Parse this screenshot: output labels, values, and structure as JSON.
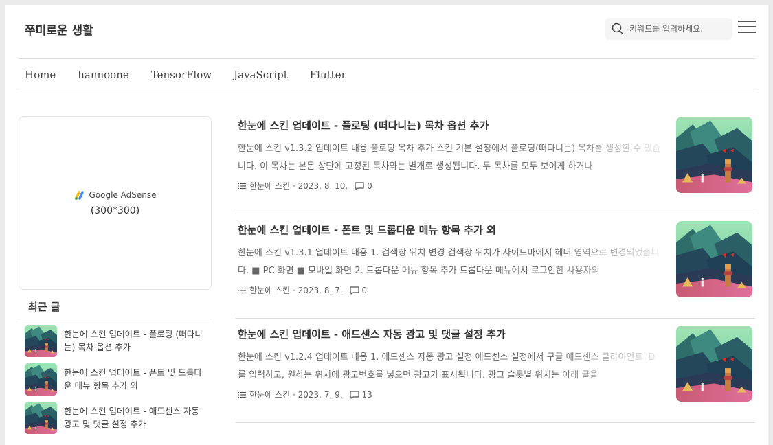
{
  "header": {
    "site_title": "쭈미로운 생활",
    "search_placeholder": "키워드를 입력하세요."
  },
  "nav": {
    "items": [
      "Home",
      "hannoone",
      "TensorFlow",
      "JavaScript",
      "Flutter"
    ]
  },
  "ad": {
    "brand": "Google AdSense",
    "size": "(300*300)"
  },
  "sidebar": {
    "recent_title": "최근 글",
    "recent": [
      {
        "title": "한눈에 스킨 업데이트 - 플로팅 (떠다니는) 목차 옵션 추가"
      },
      {
        "title": "한눈에 스킨 업데이트 - 폰트 및 드롭다운 메뉴 항목 추가 외"
      },
      {
        "title": "한눈에 스킨 업데이트 - 애드센스 자동 광고 및 댓글 설정 추가"
      }
    ]
  },
  "posts": [
    {
      "title": "한눈에 스킨 업데이트 - 플로팅 (떠다니는) 목차 옵션 추가",
      "excerpt": "한눈에 스킨 v1.3.2 업데이트 내용 플로팅 목차 추가 스킨 기본 설정에서 플로팅(떠다니는) 목차를 생성할 수 있습니다. 이 목차는 본문 상단에 고정된 목차와는 별개로 생성됩니다. 두 목차를 모두 보이게 하거나",
      "category": "한눈에 스킨",
      "date": "· 2023. 8. 10.",
      "comments": "0"
    },
    {
      "title": "한눈에 스킨 업데이트 - 폰트 및 드롭다운 메뉴 항목 추가 외",
      "excerpt": "한눈에 스킨 v1.3.1 업데이트 내용 1. 검색창 위치 변경 검색창 위치가 사이드바에서 헤더 영역으로 변경되었습니다. ■ PC 화면 ■ 모바일 화면 2. 드롭다운 메뉴 항목 추가 드롭다운 메뉴에서 로그인한 사용자의",
      "category": "한눈에 스킨",
      "date": "· 2023. 8. 7.",
      "comments": "0"
    },
    {
      "title": "한눈에 스킨 업데이트 - 애드센스 자동 광고 및 댓글 설정 추가",
      "excerpt": "한눈에 스킨 v1.2.4 업데이트 내용 1. 애드센스 자동 광고 설정 애드센스 설정에서 구글 애드센스 클라이언트 ID를 입력하고, 원하는 위치에 광고번호를 넣으면 광고가 표시됩니다. 광고 슬롯별 위치는 아래 글을",
      "category": "한눈에 스킨",
      "date": "· 2023. 7. 9.",
      "comments": "13"
    }
  ]
}
